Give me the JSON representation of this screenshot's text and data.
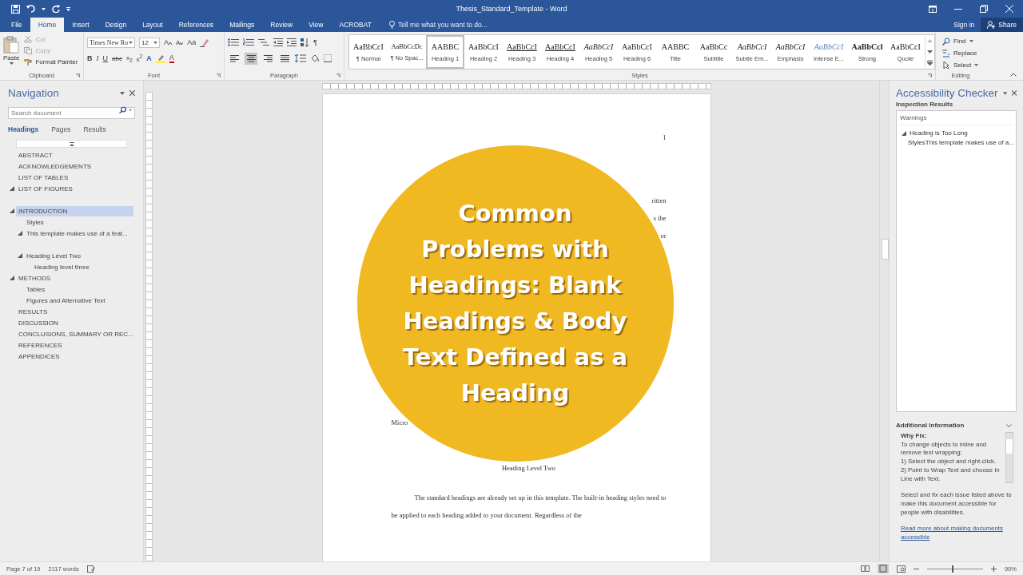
{
  "title_bar": {
    "title": "Thesis_Standard_Template - Word"
  },
  "tabs": [
    {
      "label": "File",
      "selected": false
    },
    {
      "label": "Home",
      "selected": true
    },
    {
      "label": "Insert",
      "selected": false
    },
    {
      "label": "Design",
      "selected": false
    },
    {
      "label": "Layout",
      "selected": false
    },
    {
      "label": "References",
      "selected": false
    },
    {
      "label": "Mailings",
      "selected": false
    },
    {
      "label": "Review",
      "selected": false
    },
    {
      "label": "View",
      "selected": false
    },
    {
      "label": "ACROBAT",
      "selected": false
    }
  ],
  "tell_me": {
    "placeholder": "Tell me what you want to do..."
  },
  "account": {
    "sign_in": "Sign in",
    "share": "Share"
  },
  "ribbon": {
    "clipboard": {
      "label": "Clipboard",
      "paste": "Paste",
      "items": [
        {
          "label": "Cut",
          "disabled": true
        },
        {
          "label": "Copy",
          "disabled": true
        },
        {
          "label": "Format Painter",
          "disabled": false
        }
      ]
    },
    "font": {
      "label": "Font",
      "name": "Times New Ro",
      "size": "12",
      "grow": "A",
      "shrink": "A",
      "case": "Aa",
      "styles": [
        "B",
        "I",
        "U",
        "abc",
        "x$_{2}$",
        "x$^{2}$"
      ],
      "text_effects": "A",
      "font_color_label": "A"
    },
    "paragraph": {
      "label": "Paragraph",
      "marks": "¶",
      "alignments": [
        {
          "selected": false
        },
        {
          "selected": true
        },
        {
          "selected": false
        },
        {
          "selected": false
        }
      ]
    },
    "styles": {
      "label": "Styles",
      "items": [
        {
          "preview": "AaBbCcI",
          "label": "¶ Normal",
          "kind": "plain",
          "selected": false
        },
        {
          "preview": "AaBbCcDc",
          "label": "¶ No Spac...",
          "kind": "small",
          "selected": false
        },
        {
          "preview": "AABBC",
          "label": "Heading 1",
          "kind": "plain",
          "selected": true
        },
        {
          "preview": "AaBbCcI",
          "label": "Heading 2",
          "kind": "plain",
          "selected": false
        },
        {
          "preview": "AaBbCcI",
          "label": "Heading 3",
          "kind": "underline",
          "selected": false
        },
        {
          "preview": "AaBbCcI",
          "label": "Heading 4",
          "kind": "underline",
          "selected": false
        },
        {
          "preview": "AaBbCcI",
          "label": "Heading 5",
          "kind": "italic",
          "selected": false
        },
        {
          "preview": "AaBbCcI",
          "label": "Heading 6",
          "kind": "plain",
          "selected": false
        },
        {
          "preview": "AABBC",
          "label": "Title",
          "kind": "plain",
          "selected": false
        },
        {
          "preview": "AaBbCc",
          "label": "Subtitle",
          "kind": "plain",
          "selected": false
        },
        {
          "preview": "AaBbCcI",
          "label": "Subtle Em...",
          "kind": "italic",
          "selected": false
        },
        {
          "preview": "AaBbCcI",
          "label": "Emphasis",
          "kind": "italic",
          "selected": false
        },
        {
          "preview": "AaBbCcI",
          "label": "Intense E...",
          "kind": "accent",
          "selected": false
        },
        {
          "preview": "AaBbCcl",
          "label": "Strong",
          "kind": "bold",
          "selected": false
        },
        {
          "preview": "AaBbCcI",
          "label": "Quote",
          "kind": "plain",
          "selected": false
        }
      ]
    },
    "editing": {
      "label": "Editing",
      "items": [
        {
          "label": "Find",
          "kind": "find"
        },
        {
          "label": "Replace",
          "kind": "replace"
        },
        {
          "label": "Select",
          "kind": "select"
        }
      ]
    }
  },
  "navigation": {
    "title": "Navigation",
    "search": {
      "placeholder": "Search document"
    },
    "tabs": [
      {
        "label": "Headings",
        "selected": true
      },
      {
        "label": "Pages",
        "selected": false
      },
      {
        "label": "Results",
        "selected": false
      }
    ],
    "headings": [
      {
        "label": "ABSTRACT",
        "selected": false
      },
      {
        "label": "ACKNOWLEDGEMENTS",
        "selected": false
      },
      {
        "label": "LIST OF TABLES",
        "selected": false
      },
      {
        "label": "LIST OF FIGURES",
        "selected": false,
        "expanded": true
      },
      {
        "label": "INTRODUCTION",
        "selected": true,
        "expanded": true,
        "children": [
          {
            "label": "Styles",
            "selected": false
          },
          {
            "label": "This template makes use of a feat...",
            "selected": false,
            "expanded": true
          },
          {
            "label": "Heading Level Two",
            "selected": false,
            "expanded": true,
            "children": [
              {
                "label": "Heading level three",
                "selected": false
              }
            ]
          }
        ]
      },
      {
        "label": "METHODS",
        "selected": false,
        "expanded": true,
        "children": [
          {
            "label": "Tables",
            "selected": false
          },
          {
            "label": "Figures and Alternative Text",
            "selected": false
          }
        ]
      },
      {
        "label": "RESULTS",
        "selected": false
      },
      {
        "label": "DISCUSSION",
        "selected": false
      },
      {
        "label": "CONCLUSIONS, SUMMARY OR REC...",
        "selected": false
      },
      {
        "label": "REFERENCES",
        "selected": false
      },
      {
        "label": "APPENDICES",
        "selected": false
      }
    ]
  },
  "document": {
    "page_number": "1",
    "right_fragments": [
      "ritten",
      "s the",
      "or"
    ],
    "left_fragment": "Micro",
    "heading": "Heading Level Two",
    "paragraph": "The standard headings are already set up in this template. The built-in heading styles need to be applied to each heading added to your document. Regardless of the"
  },
  "overlay": {
    "title_lines": [
      "Common",
      "Problems with",
      "Headings: Blank",
      "Headings & Body",
      "Text Defined as a",
      "Heading"
    ]
  },
  "accessibility": {
    "title": "Accessibility Checker",
    "results_label": "Inspection Results",
    "category": "Warnings",
    "issues": [
      {
        "label": "Heading is Too Long",
        "expanded": true,
        "children": [
          {
            "label": "StylesThis template makes use of a..."
          }
        ]
      }
    ],
    "additional_label": "Additional Information",
    "why_fix": "Why Fix:",
    "fix_steps": [
      "To change objects to inline and remove text wrapping:",
      "1) Select the object and right-click.",
      "2) Point to Wrap Text and choose In Line with Text."
    ],
    "summary": "Select and fix each issue listed above to make this document accessible for people with disabilities.",
    "link": "Read more about making documents accessible"
  },
  "status_bar": {
    "page": "Page 7 of 19",
    "words": "2117 words",
    "zoom": "90%",
    "zoom_slider": {
      "level": 0.45
    }
  }
}
